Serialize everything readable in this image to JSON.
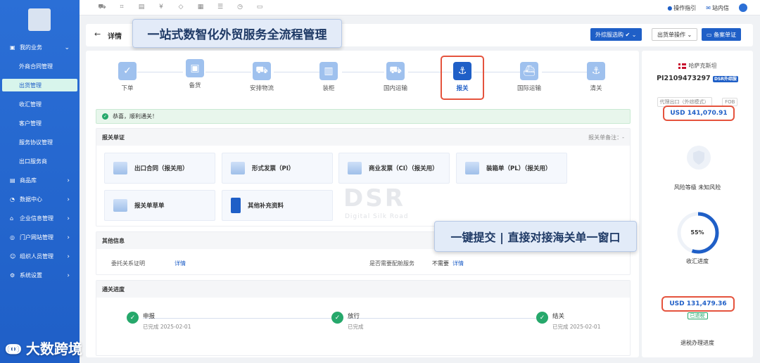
{
  "topbar": {
    "guide": "操作指引",
    "inbox": "站内信"
  },
  "nav": {
    "my_business": "我的业务",
    "subs": [
      "外商合同管理",
      "出货管理",
      "收汇管理",
      "客户管理",
      "服务协议管理",
      "出口服务商"
    ],
    "groups": [
      "商品库",
      "数据中心",
      "企业信息管理",
      "门户网站管理",
      "组织人员管理",
      "系统设置"
    ]
  },
  "header": {
    "title": "详情",
    "btn_service": "外综服选购",
    "btn_ops": "出货单操作",
    "btn_file": "备案单证"
  },
  "banner_top": "一站式数智化外贸服务全流程管理",
  "steps": [
    "下单",
    "备货",
    "安排物流",
    "装柜",
    "国内运输",
    "报关",
    "国际运输",
    "清关"
  ],
  "notice": "恭喜，顺利通关！",
  "docs_panel": {
    "title": "报关单证",
    "remark": "报关单备注：-",
    "docs": [
      "出口合同（报关用）",
      "形式发票（PI）",
      "商业发票（CI）（报关用）",
      "装箱单（PL）（报关用）",
      "报关单草单",
      "其他补充资料"
    ]
  },
  "other_panel": {
    "title": "其他信息",
    "entrust_label": "委托关系证明",
    "entrust_link": "详情",
    "need_label": "是否需要配舱服务",
    "need_value": "不需要",
    "need_link": "详情"
  },
  "banner_mid": "一键提交 | 直接对接海关单一窗口",
  "watermark": "DSR",
  "watermark_sub": "Digital Silk Road",
  "clearance": {
    "title": "通关进度",
    "items": [
      {
        "name": "申报",
        "status": "已完成 2025-02-01"
      },
      {
        "name": "放行",
        "status": "已完成"
      },
      {
        "name": "结关",
        "status": "已完成 2025-02-01"
      }
    ]
  },
  "right": {
    "country": "哈萨克斯坦",
    "pi": "PI2109473297",
    "badge": "DSR外综服",
    "tag1": "代理出口（外综模式）",
    "tag2": "FOB",
    "usd1": "USD  141,070.91",
    "risk": "风险等级  未知风险",
    "progress": "55%",
    "progress_value": 0.55,
    "progress_label": "收汇进度",
    "usd2": "USD 131,479.36",
    "refunded": "已退税",
    "tax_label": "退税办理进度"
  },
  "bottom_logo": "大数跨境",
  "colors": {
    "primary": "#1f5fc7",
    "success": "#26a86b",
    "highlight": "#e5533d"
  }
}
